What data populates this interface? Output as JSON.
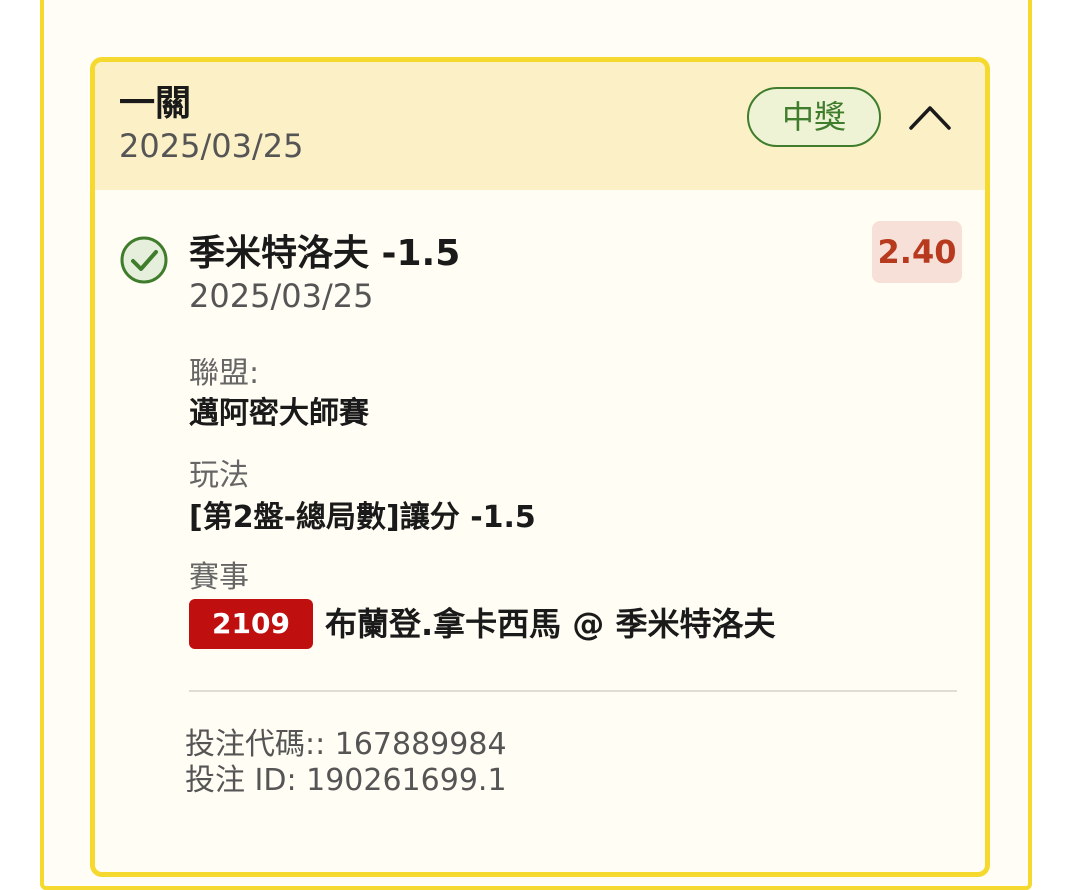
{
  "bet": {
    "type_label": "一關",
    "date": "2025/03/25",
    "status_label": "中獎",
    "selection": {
      "title": "季米特洛夫 -1.5",
      "date": "2025/03/25",
      "odds": "2.40",
      "status": "won"
    },
    "league": {
      "label": "聯盟:",
      "value": "邁阿密大師賽"
    },
    "market": {
      "label": "玩法",
      "value": "[第2盤-總局數]讓分 -1.5"
    },
    "event": {
      "label": "賽事",
      "code": "2109",
      "name": "布蘭登.拿卡西馬 @ 季米特洛夫"
    },
    "footer": {
      "bet_code": "投注代碼:: 167889984",
      "bet_id": "投注 ID: 190261699.1"
    }
  },
  "colors": {
    "card_border": "#f6d92e",
    "header_bg": "#fbf0c6",
    "win_green": "#3f7d2c",
    "odds_red": "#b83a1e",
    "code_red": "#c00f0f"
  },
  "icons": {
    "collapse": "chevron-up-icon",
    "status": "check-circle-icon"
  }
}
